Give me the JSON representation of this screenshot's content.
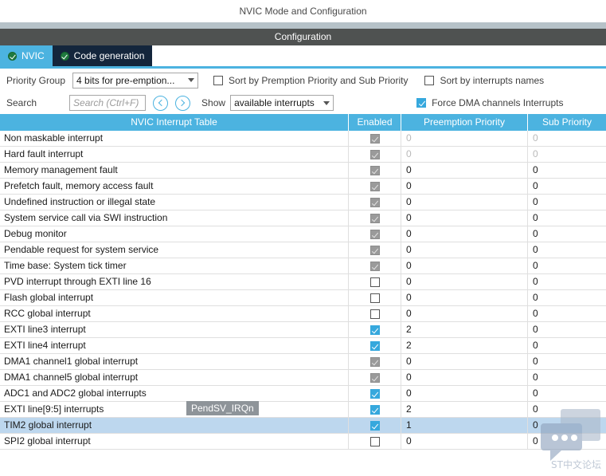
{
  "window": {
    "title": "NVIC Mode and Configuration"
  },
  "config_bar": {
    "label": "Configuration"
  },
  "tabs": [
    {
      "label": "NVIC",
      "icon": "check-circle-icon",
      "active": true
    },
    {
      "label": "Code generation",
      "icon": "check-circle-icon",
      "active": false
    }
  ],
  "toolbar": {
    "priority_group_label": "Priority Group",
    "priority_group_value": "4 bits for pre-emption...",
    "sort_premption_label": "Sort by Premption Priority and Sub Priority",
    "sort_premption_checked": false,
    "sort_names_label": "Sort by interrupts names",
    "sort_names_checked": false,
    "search_label": "Search",
    "search_value": "",
    "search_placeholder": "Search (Ctrl+F)",
    "prev_icon": "chevron-left-circle-icon",
    "next_icon": "chevron-right-circle-icon",
    "show_label": "Show",
    "show_value": "available interrupts",
    "force_dma_label": "Force DMA channels Interrupts",
    "force_dma_checked": true
  },
  "table": {
    "columns": [
      "NVIC Interrupt Table",
      "Enabled",
      "Preemption Priority",
      "Sub Priority"
    ],
    "rows": [
      {
        "name": "Non maskable interrupt",
        "enabled": "disabled-checked",
        "preemption": "0",
        "sub": "0",
        "muted": true,
        "selected": false
      },
      {
        "name": "Hard fault interrupt",
        "enabled": "disabled-checked",
        "preemption": "0",
        "sub": "0",
        "muted": true,
        "selected": false
      },
      {
        "name": "Memory management fault",
        "enabled": "disabled-checked",
        "preemption": "0",
        "sub": "0",
        "muted": false,
        "selected": false
      },
      {
        "name": "Prefetch fault, memory access fault",
        "enabled": "disabled-checked",
        "preemption": "0",
        "sub": "0",
        "muted": false,
        "selected": false
      },
      {
        "name": "Undefined instruction or illegal state",
        "enabled": "disabled-checked",
        "preemption": "0",
        "sub": "0",
        "muted": false,
        "selected": false
      },
      {
        "name": "System service call via SWI instruction",
        "enabled": "disabled-checked",
        "preemption": "0",
        "sub": "0",
        "muted": false,
        "selected": false
      },
      {
        "name": "Debug monitor",
        "enabled": "disabled-checked",
        "preemption": "0",
        "sub": "0",
        "muted": false,
        "selected": false
      },
      {
        "name": "Pendable request for system service",
        "enabled": "disabled-checked",
        "preemption": "0",
        "sub": "0",
        "muted": false,
        "selected": false
      },
      {
        "name": "Time base: System tick timer",
        "enabled": "disabled-checked",
        "preemption": "0",
        "sub": "0",
        "muted": false,
        "selected": false
      },
      {
        "name": "PVD interrupt through EXTI line 16",
        "enabled": "unchecked",
        "preemption": "0",
        "sub": "0",
        "muted": false,
        "selected": false
      },
      {
        "name": "Flash global interrupt",
        "enabled": "unchecked",
        "preemption": "0",
        "sub": "0",
        "muted": false,
        "selected": false
      },
      {
        "name": "RCC global interrupt",
        "enabled": "unchecked",
        "preemption": "0",
        "sub": "0",
        "muted": false,
        "selected": false
      },
      {
        "name": "EXTI line3 interrupt",
        "enabled": "checked",
        "preemption": "2",
        "sub": "0",
        "muted": false,
        "selected": false
      },
      {
        "name": "EXTI line4 interrupt",
        "enabled": "checked",
        "preemption": "2",
        "sub": "0",
        "muted": false,
        "selected": false
      },
      {
        "name": "DMA1 channel1 global interrupt",
        "enabled": "disabled-checked",
        "preemption": "0",
        "sub": "0",
        "muted": false,
        "selected": false
      },
      {
        "name": "DMA1 channel5 global interrupt",
        "enabled": "disabled-checked",
        "preemption": "0",
        "sub": "0",
        "muted": false,
        "selected": false
      },
      {
        "name": "ADC1 and ADC2 global interrupts",
        "enabled": "checked",
        "preemption": "0",
        "sub": "0",
        "muted": false,
        "selected": false
      },
      {
        "name": "EXTI line[9:5] interrupts",
        "enabled": "checked",
        "preemption": "2",
        "sub": "0",
        "muted": false,
        "selected": false
      },
      {
        "name": "TIM2 global interrupt",
        "enabled": "checked",
        "preemption": "1",
        "sub": "0",
        "muted": false,
        "selected": true
      },
      {
        "name": "SPI2 global interrupt",
        "enabled": "unchecked",
        "preemption": "0",
        "sub": "0",
        "muted": false,
        "selected": false
      }
    ]
  },
  "tooltip": {
    "text": "PendSV_IRQn"
  },
  "watermark": {
    "text": "ST中文论坛",
    "icon": "chat-bubbles-icon"
  },
  "colors": {
    "accent": "#4cb3e0",
    "tab_inactive": "#14263c",
    "config_bar": "#4f5251",
    "selection": "#bdd7ee",
    "title_strip": "#b6c2c8"
  }
}
